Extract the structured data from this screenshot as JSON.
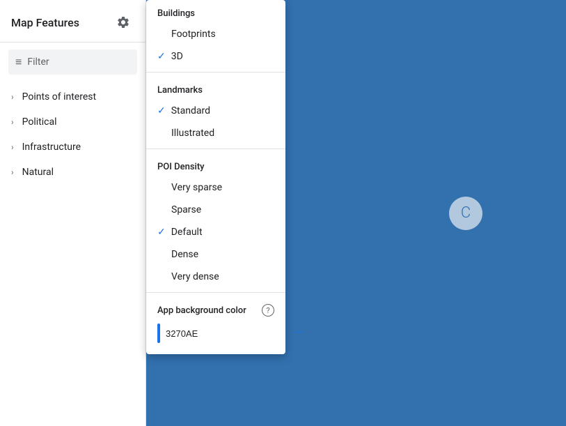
{
  "sidebar": {
    "title": "Map Features",
    "filter_placeholder": "Filter",
    "nav_items": [
      {
        "label": "Points of interest"
      },
      {
        "label": "Political"
      },
      {
        "label": "Infrastructure"
      },
      {
        "label": "Natural"
      }
    ]
  },
  "dropdown": {
    "sections": [
      {
        "label": "Buildings",
        "items": [
          {
            "label": "Footprints",
            "checked": false
          },
          {
            "label": "3D",
            "checked": true
          }
        ]
      },
      {
        "label": "Landmarks",
        "items": [
          {
            "label": "Standard",
            "checked": true
          },
          {
            "label": "Illustrated",
            "checked": false
          }
        ]
      },
      {
        "label": "POI Density",
        "items": [
          {
            "label": "Very sparse",
            "checked": false
          },
          {
            "label": "Sparse",
            "checked": false
          },
          {
            "label": "Default",
            "checked": true
          },
          {
            "label": "Dense",
            "checked": false
          },
          {
            "label": "Very dense",
            "checked": false
          }
        ]
      }
    ],
    "bg_color": {
      "label": "App background color",
      "hex_value": "3270AE",
      "clear_label": "—"
    }
  },
  "map": {
    "bg_color": "#3270ae",
    "spinner_letter": "C"
  },
  "icons": {
    "gear": "gear-icon",
    "filter": "≡",
    "check": "✓",
    "question": "?",
    "chevron": "›"
  }
}
